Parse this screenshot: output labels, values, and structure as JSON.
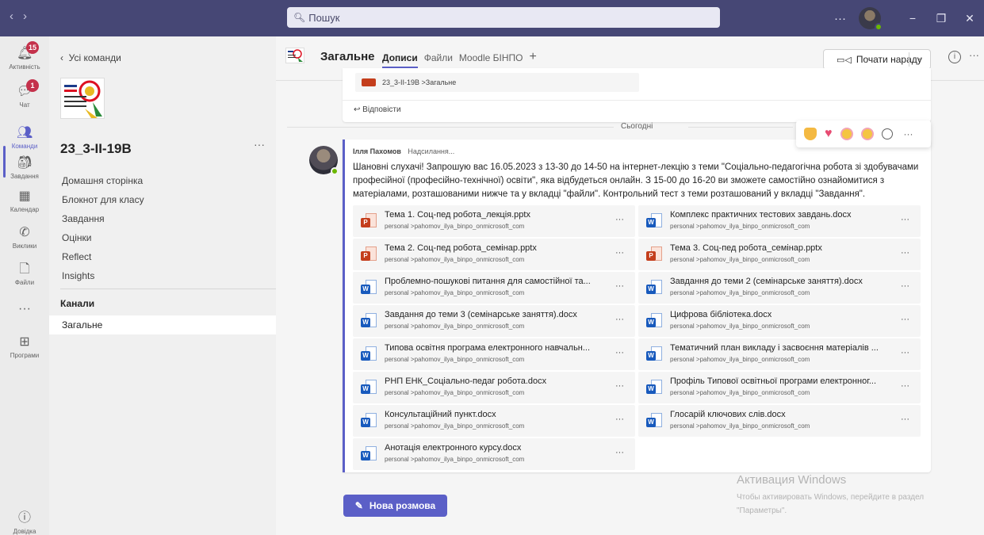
{
  "titlebar": {
    "search_placeholder": "Пошук",
    "more": "···",
    "window_min": "−",
    "window_max": "❐",
    "window_close": "✕"
  },
  "rail": {
    "items": [
      {
        "label": "Активність",
        "badge": "15",
        "icon": "bell-icon"
      },
      {
        "label": "Чат",
        "badge": "1",
        "icon": "chat-icon"
      },
      {
        "label": "Команди",
        "badge": "",
        "icon": "teams-icon"
      },
      {
        "label": "Завдання",
        "badge": "",
        "icon": "assignments-icon"
      },
      {
        "label": "Календар",
        "badge": "",
        "icon": "calendar-icon"
      },
      {
        "label": "Виклики",
        "badge": "",
        "icon": "phone-icon"
      },
      {
        "label": "Файли",
        "badge": "",
        "icon": "file-icon"
      },
      {
        "label": "",
        "badge": "",
        "icon": "more-icon"
      },
      {
        "label": "Програми",
        "badge": "",
        "icon": "apps-icon"
      },
      {
        "label": "Довідка",
        "badge": "",
        "icon": "help-icon"
      }
    ]
  },
  "panel": {
    "back_label": "Усі команди",
    "team_name": "23_3-II-19B",
    "links": [
      "Домашня сторінка",
      "Блокнот для класу",
      "Завдання",
      "Оцінки",
      "Reflect",
      "Insights"
    ],
    "channels_heading": "Канали",
    "active_channel": "Загальне"
  },
  "header": {
    "title": "Загальне",
    "tabs": [
      "Дописи",
      "Файли",
      "Moodle БІНПО"
    ],
    "add_tab": "+",
    "meet_label": "Почати нараду"
  },
  "prev_message": {
    "attachment": "23_3-II-19B >Загальне",
    "reply_label": "Відповісти"
  },
  "today_label": "Сьогодні",
  "message": {
    "author": "Ілля Пахомов",
    "status": "Надсилання...",
    "text": "Шановні слухачі! Запрошую вас 16.05.2023 з 13-30 до 14-50 на інтернет-лекцію з теми \"Соціально-педагогічна робота зі здобувачами професійної (професійно-технічної) освіти\", яка відбудеться онлайн. З 15-00 до 16-20 ви зможете самостійно ознайомитися з матеріалами, розташованими нижче та у вкладці \"файли\". Контрольний тест з теми розташований у вкладці \"Завдання\".",
    "files": [
      {
        "name": "Тема 1. Соц-пед робота_лекція.pptx",
        "path": "personal >pahomov_ilya_binpo_onmicrosoft_com",
        "type": "pptx"
      },
      {
        "name": "Комплекс практичних тестових завдань.docx",
        "path": "personal >pahomov_ilya_binpo_onmicrosoft_com",
        "type": "docx"
      },
      {
        "name": "Тема 2. Соц-пед робота_семінар.pptx",
        "path": "personal >pahomov_ilya_binpo_onmicrosoft_com",
        "type": "pptx"
      },
      {
        "name": "Тема 3. Соц-пед робота_семінар.pptx",
        "path": "personal >pahomov_ilya_binpo_onmicrosoft_com",
        "type": "pptx"
      },
      {
        "name": "Проблемно-пошукові питання для самостійної та...",
        "path": "personal >pahomov_ilya_binpo_onmicrosoft_com",
        "type": "docx"
      },
      {
        "name": "Завдання до теми 2 (семінарське заняття).docx",
        "path": "personal >pahomov_ilya_binpo_onmicrosoft_com",
        "type": "docx"
      },
      {
        "name": "Завдання до теми 3 (семінарське заняття).docx",
        "path": "personal >pahomov_ilya_binpo_onmicrosoft_com",
        "type": "docx"
      },
      {
        "name": "Цифрова бібліотека.docx",
        "path": "personal >pahomov_ilya_binpo_onmicrosoft_com",
        "type": "docx"
      },
      {
        "name": "Типова освітня програма електронного навчальн...",
        "path": "personal >pahomov_ilya_binpo_onmicrosoft_com",
        "type": "docx"
      },
      {
        "name": "Тематичний план викладу і засвоєння матеріалів ...",
        "path": "personal >pahomov_ilya_binpo_onmicrosoft_com",
        "type": "docx"
      },
      {
        "name": "РНП ЕНК_Соціально-педаг робота.docx",
        "path": "personal >pahomov_ilya_binpo_onmicrosoft_com",
        "type": "docx"
      },
      {
        "name": "Профіль Типової освітньої програми електронног...",
        "path": "personal >pahomov_ilya_binpo_onmicrosoft_com",
        "type": "docx"
      },
      {
        "name": "Консультаційний пункт.docx",
        "path": "personal >pahomov_ilya_binpo_onmicrosoft_com",
        "type": "docx"
      },
      {
        "name": "Глосарій ключових слів.docx",
        "path": "personal >pahomov_ilya_binpo_onmicrosoft_com",
        "type": "docx"
      },
      {
        "name": "Анотація електронного курсу.docx",
        "path": "personal >pahomov_ilya_binpo_onmicrosoft_com",
        "type": "docx"
      }
    ]
  },
  "new_conversation_label": "Нова розмова",
  "watermark": {
    "title": "Активация Windows",
    "subtitle": "Чтобы активировать Windows, перейдите в раздел \"Параметры\"."
  },
  "colors": {
    "titlebar": "#464775",
    "accent": "#5b5fc7",
    "badge": "#c4314b",
    "presence": "#6bb700",
    "pptx": "#c43e1c",
    "docx": "#185abd"
  }
}
